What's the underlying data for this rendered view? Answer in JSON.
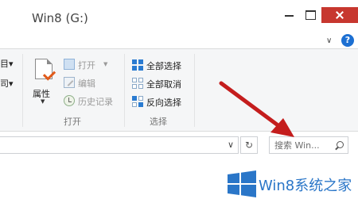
{
  "window": {
    "title": "Win8 (G:)"
  },
  "ribbon": {
    "clipped_labels": [
      "目▾",
      "司▾"
    ],
    "properties": {
      "label": "属性"
    },
    "open_group": {
      "label": "打开",
      "items": [
        {
          "label": "打开",
          "icon": "open-icon",
          "enabled": false,
          "has_dropdown": true
        },
        {
          "label": "编辑",
          "icon": "edit-icon",
          "enabled": false
        },
        {
          "label": "历史记录",
          "icon": "history-icon",
          "enabled": false
        }
      ]
    },
    "select_group": {
      "label": "选择",
      "items": [
        {
          "label": "全部选择",
          "icon": "select-all-icon"
        },
        {
          "label": "全部取消",
          "icon": "select-none-icon"
        },
        {
          "label": "反向选择",
          "icon": "invert-selection-icon"
        }
      ]
    }
  },
  "search": {
    "placeholder": "搜索 Win..."
  },
  "watermark": {
    "text": "Win8系统之家"
  },
  "colors": {
    "close_button": "#c7372f",
    "help_icon": "#1c6fd2",
    "arrow": "#c41d1d",
    "watermark_blue": "#2a76c8",
    "ribbon_background": "#f5f6f7"
  }
}
